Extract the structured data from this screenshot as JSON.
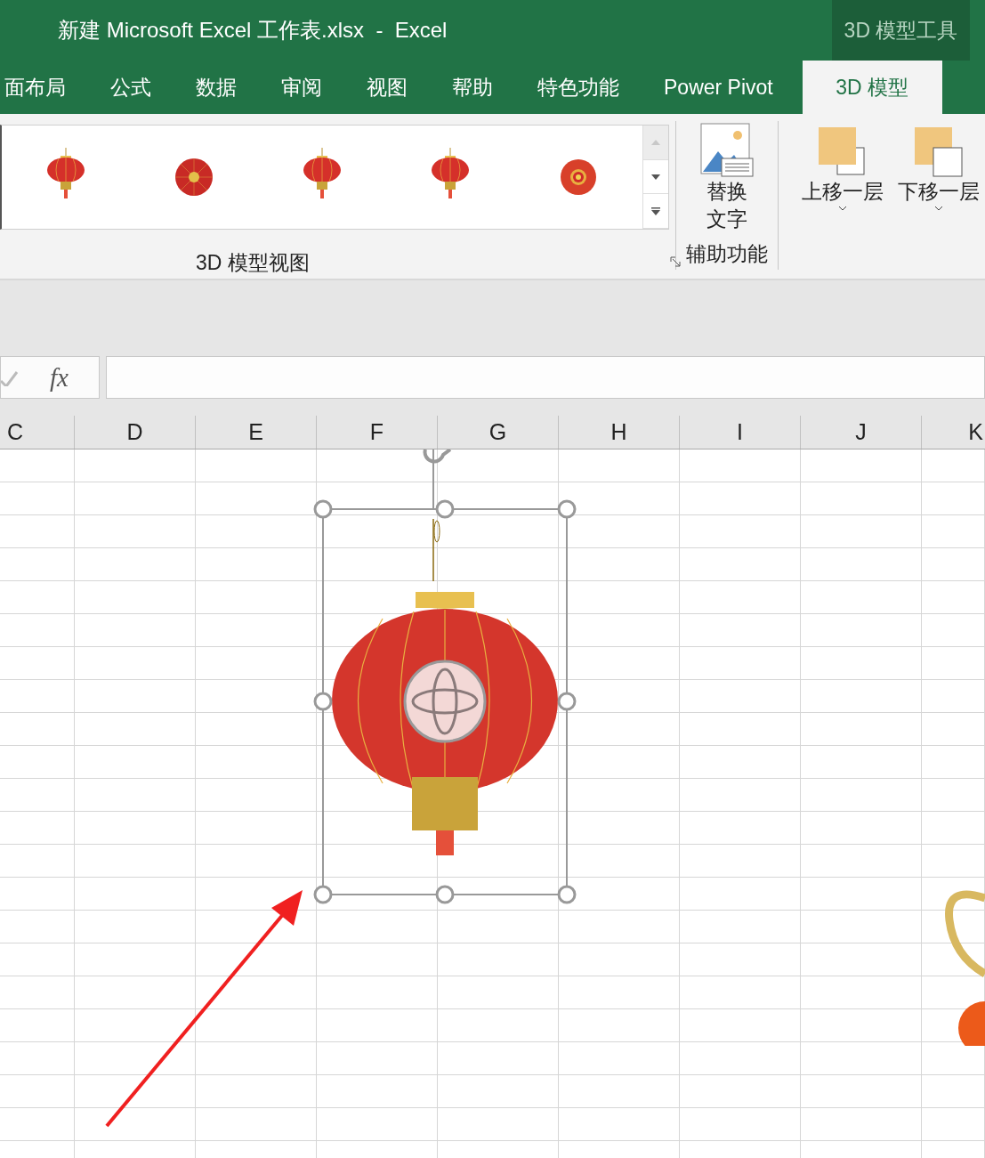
{
  "window": {
    "title": "新建 Microsoft Excel 工作表.xlsx  -  Excel",
    "context_group": "3D 模型工具"
  },
  "tabs": [
    {
      "label": "面布局",
      "selected": false
    },
    {
      "label": "公式",
      "selected": false
    },
    {
      "label": "数据",
      "selected": false
    },
    {
      "label": "审阅",
      "selected": false
    },
    {
      "label": "视图",
      "selected": false
    },
    {
      "label": "帮助",
      "selected": false
    },
    {
      "label": "特色功能",
      "selected": false
    },
    {
      "label": "Power Pivot",
      "selected": false
    },
    {
      "label": "3D 模型",
      "selected": true
    }
  ],
  "ribbon": {
    "gallery": {
      "views": [
        {
          "kind": "side"
        },
        {
          "kind": "top"
        },
        {
          "kind": "side"
        },
        {
          "kind": "side"
        },
        {
          "kind": "bottom"
        }
      ],
      "label": "3D 模型视图"
    },
    "accessibility": {
      "button": "替换文字",
      "label": "辅助功能"
    },
    "arrange": [
      {
        "label": "上移一层",
        "kind": "forward"
      },
      {
        "label": "下移一层",
        "kind": "backward"
      }
    ]
  },
  "formula_bar": {
    "fx": "fx"
  },
  "columns": [
    "C",
    "D",
    "E",
    "F",
    "G",
    "H",
    "I",
    "J",
    "K"
  ]
}
